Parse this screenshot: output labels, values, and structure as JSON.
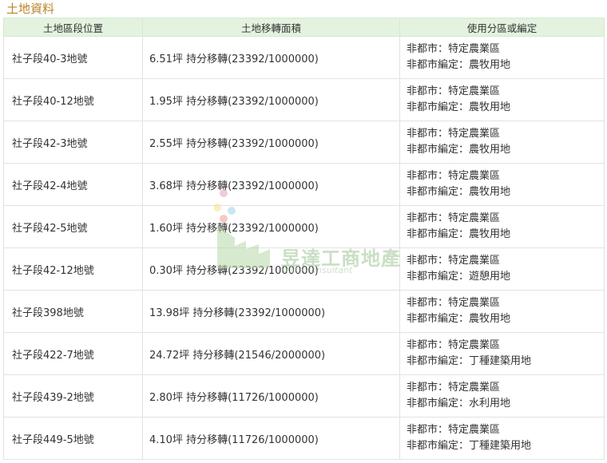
{
  "section_title": "土地資料",
  "table": {
    "headers": [
      "土地區段位置",
      "土地移轉面積",
      "使用分區或編定"
    ],
    "rows": [
      {
        "location": "社子段40-3地號",
        "area": "6.51坪 持分移轉(23392/1000000)",
        "zone_line1": "非都市：特定農業區",
        "zone_line2": "非都市編定：農牧用地"
      },
      {
        "location": "社子段40-12地號",
        "area": "1.95坪 持分移轉(23392/1000000)",
        "zone_line1": "非都市：特定農業區",
        "zone_line2": "非都市編定：農牧用地"
      },
      {
        "location": "社子段42-3地號",
        "area": "2.55坪 持分移轉(23392/1000000)",
        "zone_line1": "非都市：特定農業區",
        "zone_line2": "非都市編定：農牧用地"
      },
      {
        "location": "社子段42-4地號",
        "area": "3.68坪 持分移轉(23392/1000000)",
        "zone_line1": "非都市：特定農業區",
        "zone_line2": "非都市編定：農牧用地"
      },
      {
        "location": "社子段42-5地號",
        "area": "1.60坪 持分移轉(23392/1000000)",
        "zone_line1": "非都市：特定農業區",
        "zone_line2": "非都市編定：農牧用地"
      },
      {
        "location": "社子段42-12地號",
        "area": "0.30坪 持分移轉(23392/1000000)",
        "zone_line1": "非都市：特定農業區",
        "zone_line2": "非都市編定：遊憩用地"
      },
      {
        "location": "社子段398地號",
        "area": "13.98坪 持分移轉(23392/1000000)",
        "zone_line1": "非都市：特定農業區",
        "zone_line2": "非都市編定：農牧用地"
      },
      {
        "location": "社子段422-7地號",
        "area": "24.72坪 持分移轉(21546/2000000)",
        "zone_line1": "非都市：特定農業區",
        "zone_line2": "非都市編定：丁種建築用地"
      },
      {
        "location": "社子段439-2地號",
        "area": "2.80坪 持分移轉(11726/1000000)",
        "zone_line1": "非都市：特定農業區",
        "zone_line2": "非都市編定：水利用地"
      },
      {
        "location": "社子段449-5地號",
        "area": "4.10坪 持分移轉(11726/1000000)",
        "zone_line1": "非都市：特定農業區",
        "zone_line2": "非都市編定：丁種建築用地"
      }
    ]
  },
  "watermark": {
    "name": "昱達工商地產",
    "subtitle": "state consultant",
    "colors": [
      "#b7d9a8",
      "#e7a0c6",
      "#f3e48a",
      "#9fd1ea",
      "#f39a9a"
    ]
  }
}
